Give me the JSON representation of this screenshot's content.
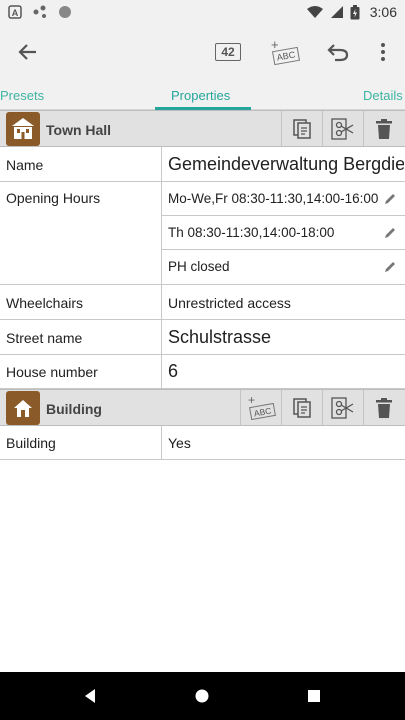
{
  "status_bar": {
    "time": "3:06",
    "icons": [
      "a-box-icon",
      "share-dots-icon",
      "circle-icon",
      "wifi-icon",
      "signal-icon",
      "battery-icon"
    ]
  },
  "app_bar": {
    "back_icon": "arrow-left-icon",
    "counter_label": "42",
    "abc_label": "ABC",
    "undo_icon": "undo-icon",
    "menu_icon": "overflow-menu-icon"
  },
  "tabs": [
    {
      "label": "Presets"
    },
    {
      "label": "Properties"
    },
    {
      "label": "Details"
    }
  ],
  "sections": {
    "town_hall": {
      "title": "Town Hall",
      "rows": {
        "name": {
          "key": "Name",
          "value": "Gemeindeverwaltung Bergdietikon"
        },
        "opening_hours": {
          "key": "Opening Hours",
          "values": [
            "Mo-We,Fr 08:30-11:30,14:00-16:00",
            "Th 08:30-11:30,14:00-18:00",
            "PH closed"
          ]
        },
        "wheelchairs": {
          "key": "Wheelchairs",
          "value": "Unrestricted access"
        },
        "street": {
          "key": "Street name",
          "value": "Schulstrasse"
        },
        "house_number": {
          "key": "House number",
          "value": "6"
        }
      }
    },
    "building": {
      "title": "Building",
      "abc_label": "ABC",
      "rows": {
        "building": {
          "key": "Building",
          "value": "Yes"
        }
      }
    }
  },
  "colors": {
    "accent": "#26a69a",
    "icon_brown": "#8a5a28",
    "toolbar_bg": "#f1f1f1",
    "section_bg": "#e1e1e1"
  }
}
